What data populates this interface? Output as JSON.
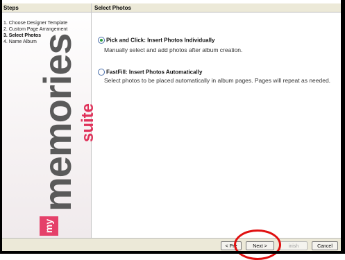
{
  "sidebar": {
    "header": "Steps",
    "steps": [
      {
        "label": "1. Choose Designer Template"
      },
      {
        "label": "2. Custom Page Arrangement"
      },
      {
        "label": "3. Select Photos"
      },
      {
        "label": "4. Name Album"
      }
    ],
    "logo": {
      "prefix": "my",
      "name": "memories",
      "suffix": "suite"
    }
  },
  "main": {
    "header": "Select Photos",
    "options": [
      {
        "title": "Pick and Click: Insert Photos Individually",
        "description": "Manually select and add photos after album creation.",
        "selected": true
      },
      {
        "title": "FastFill: Insert Photos Automatically",
        "description": "Select photos to be placed automatically in album pages. Pages will repeat as needed.",
        "selected": false
      }
    ]
  },
  "buttons": {
    "prev": "< Pre",
    "next": "Next >",
    "finish": "inish",
    "cancel": "Cancel"
  },
  "colors": {
    "annotation": "#e01010",
    "brand_pink": "#e0325a"
  }
}
